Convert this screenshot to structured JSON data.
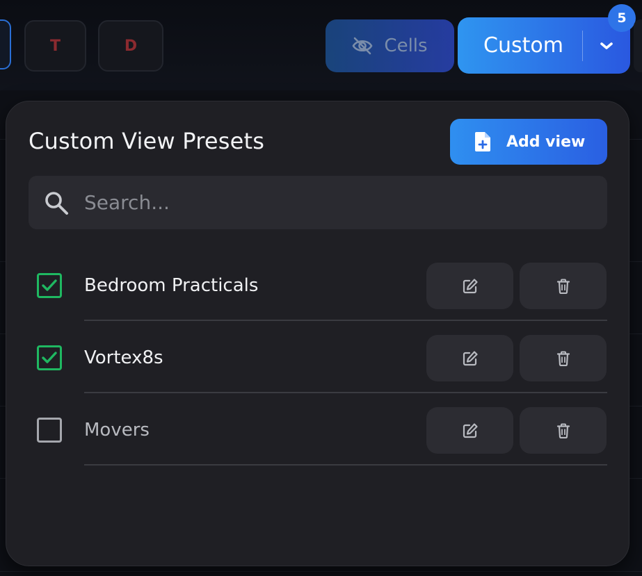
{
  "toolbar": {
    "letter_buttons": [
      "T",
      "D"
    ],
    "cells_label": "Cells",
    "custom_label": "Custom",
    "badge_count": "5"
  },
  "panel": {
    "title": "Custom View Presets",
    "add_view_label": "Add view",
    "search_placeholder": "Search...",
    "search_value": ""
  },
  "presets": [
    {
      "label": "Bedroom Practicals",
      "checked": true
    },
    {
      "label": "Vortex8s",
      "checked": true
    },
    {
      "label": "Movers",
      "checked": false
    }
  ],
  "colors": {
    "accent_blue": "#2f8ff0",
    "check_green": "#1fb861",
    "panel_bg": "#1f1f24",
    "letter_red": "#8b2a2f"
  },
  "icons": {
    "cells": "eye-off-icon",
    "custom_toggle": "chevron-down-icon",
    "add_view": "file-plus-icon",
    "search": "search-icon",
    "edit": "edit-icon",
    "delete": "trash-icon",
    "check": "check-icon"
  }
}
